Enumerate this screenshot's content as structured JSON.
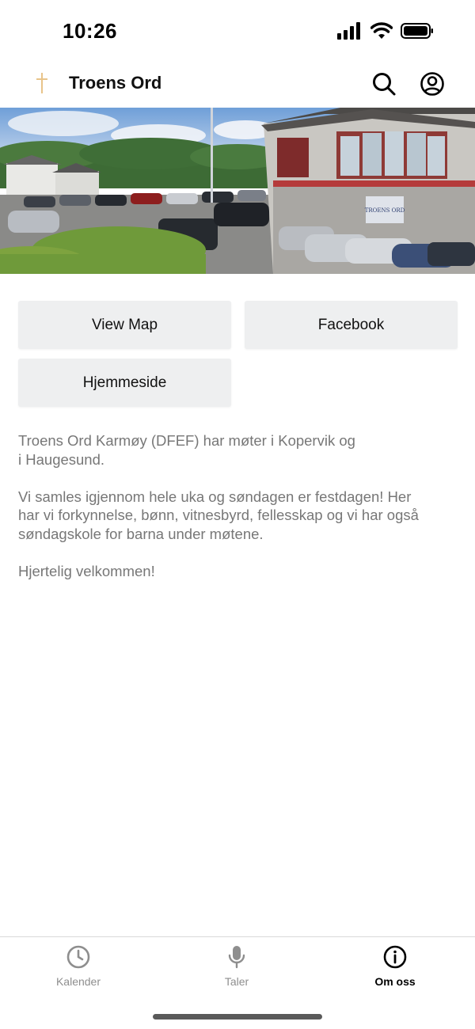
{
  "status_bar": {
    "time": "10:26",
    "icons": [
      "cellular-signal-icon",
      "wifi-icon",
      "battery-icon"
    ]
  },
  "header": {
    "title": "Troens Ord",
    "logo_icon": "cross-logo-icon",
    "actions": [
      "search-icon",
      "account-icon"
    ]
  },
  "hero": {
    "sign_text": "TROENS ORD"
  },
  "buttons": {
    "view_map": "View Map",
    "facebook": "Facebook",
    "homepage": "Hjemmeside"
  },
  "description": {
    "line1": "Troens Ord Karmøy (DFEF) har møter i Kopervik og",
    "line2": "i Haugesund.",
    "p2_line1": "Vi samles igjennom hele uka og søndagen er festdagen! Her",
    "p2_line2": "har vi forkynnelse, bønn, vitnesbyrd, fellesskap og vi har også",
    "p2_line3": "søndagskole for barna under møtene.",
    "p3": "Hjertelig velkommen!"
  },
  "tab_bar": {
    "tabs": [
      {
        "label": "Kalender",
        "icon": "clock-icon",
        "active": false
      },
      {
        "label": "Taler",
        "icon": "microphone-icon",
        "active": false
      },
      {
        "label": "Om oss",
        "icon": "info-icon",
        "active": true
      }
    ]
  },
  "colors": {
    "button_bg": "#eeeff0",
    "text_muted": "#777777",
    "tab_inactive": "#8e8e8e",
    "tab_active": "#000000",
    "logo_gold": "#e8c48a"
  }
}
